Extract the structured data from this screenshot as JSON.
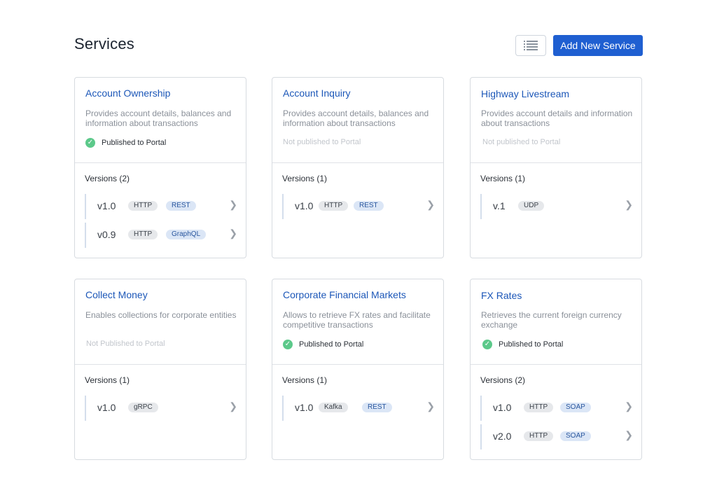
{
  "page": {
    "title": "Services",
    "add_button": "Add New Service",
    "view_toggle_icon": "list-icon"
  },
  "cards": [
    {
      "title": "Account Ownership",
      "description": "Provides account details, balances and information about transactions",
      "status": "Published to Portal",
      "published": true,
      "versions_title": "Versions (2)",
      "versions": [
        {
          "label": "v1.0",
          "protocol": "HTTP",
          "type": "REST"
        },
        {
          "label": "v0.9",
          "protocol": "HTTP",
          "type": "GraphQL"
        }
      ]
    },
    {
      "title": "Account Inquiry",
      "description": "Provides account details, balances and information about transactions",
      "status": "Not published to Portal",
      "published": false,
      "versions_title": "Versions (1)",
      "versions": [
        {
          "label": "v1.0",
          "protocol": "HTTP",
          "type": "REST"
        }
      ]
    },
    {
      "title": "Highway Livestream",
      "description": "Provides account details and information about transactions",
      "status": "Not published to Portal",
      "published": false,
      "versions_title": "Versions (1)",
      "versions": [
        {
          "label": "v.1",
          "protocol": "UDP"
        }
      ]
    },
    {
      "title": "Collect Money",
      "description": "Enables collections for corporate entities",
      "status": "Not Published to Portal",
      "published": false,
      "versions_title": "Versions (1)",
      "versions": [
        {
          "label": "v1.0",
          "protocol": "gRPC"
        }
      ]
    },
    {
      "title": "Corporate Financial Markets",
      "description": "Allows to retrieve FX rates and facilitate competitive transactions",
      "status": "Published to Portal",
      "published": true,
      "versions_title": "Versions (1)",
      "versions": [
        {
          "label": "v1.0",
          "protocol": "Kafka",
          "type": "REST"
        }
      ]
    },
    {
      "title": "FX Rates",
      "description": "Retrieves the current foreign currency exchange",
      "status": "Published to Portal",
      "published": true,
      "versions_title": "Versions (2)",
      "versions": [
        {
          "label": "v1.0",
          "protocol": "HTTP",
          "type": "SOAP"
        },
        {
          "label": "v2.0",
          "protocol": "HTTP",
          "type": "SOAP"
        }
      ]
    }
  ],
  "colors": {
    "accent": "#1f5fd1",
    "title": "#1c57b8",
    "success": "#5cc98a"
  },
  "icons": {
    "chevron": "chevron-right-icon",
    "check": "check-circle-icon"
  }
}
